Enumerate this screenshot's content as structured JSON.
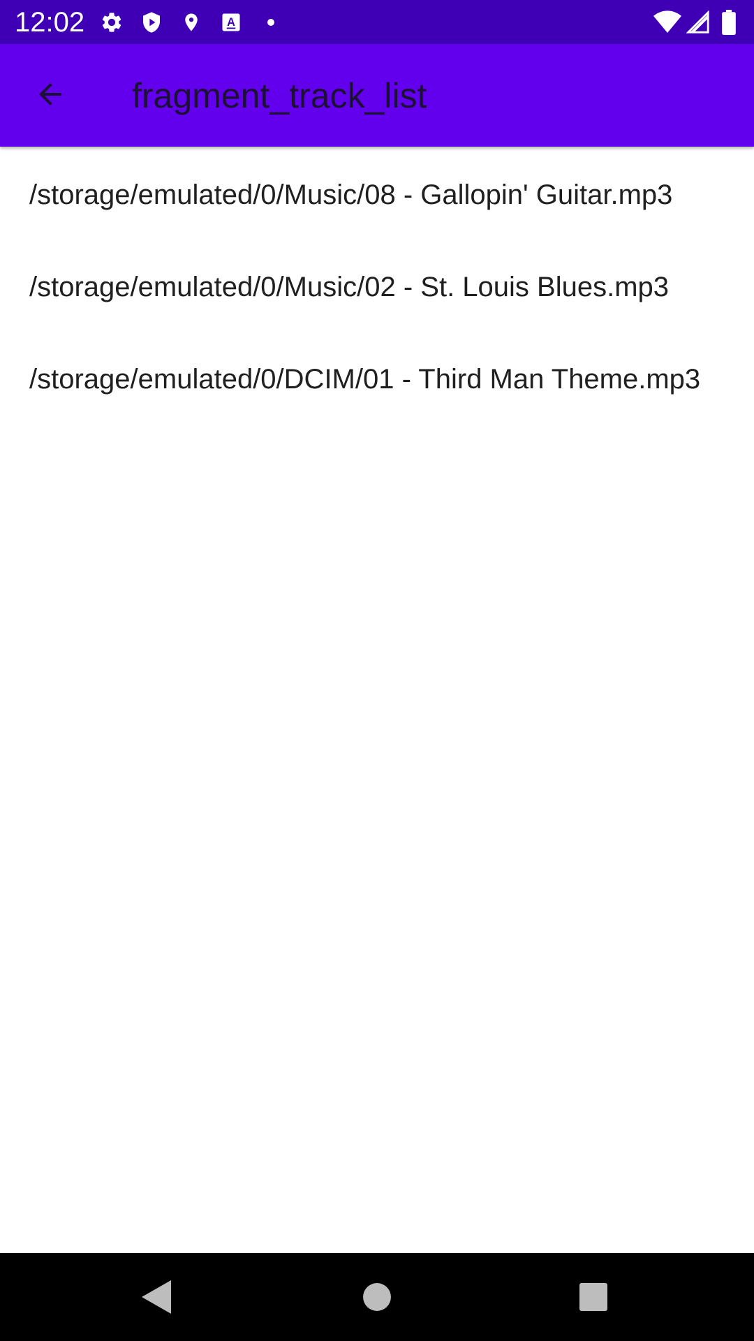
{
  "colors": {
    "status_bar": "#3f00b5",
    "app_bar": "#6200ee",
    "title_text": "#1c1034",
    "list_text": "#1f1f1f",
    "nav_bar": "#000000",
    "nav_icons": "#bdbdbd"
  },
  "status_bar": {
    "time": "12:02",
    "left_icons": [
      "settings-gear-icon",
      "shield-icon",
      "location-pin-icon",
      "keyboard-a-icon",
      "dot-icon"
    ],
    "right_icons": [
      "wifi-icon",
      "cellular-signal-icon",
      "battery-icon"
    ]
  },
  "app_bar": {
    "back_icon": "arrow-back-icon",
    "title": "fragment_track_list"
  },
  "tracks": [
    {
      "path": "/storage/emulated/0/Music/08 - Gallopin' Guitar.mp3"
    },
    {
      "path": "/storage/emulated/0/Music/02 - St. Louis Blues.mp3"
    },
    {
      "path": "/storage/emulated/0/DCIM/01 - Third Man Theme.mp3"
    }
  ],
  "nav_bar": {
    "icons": [
      "back-triangle-icon",
      "home-circle-icon",
      "recents-square-icon"
    ]
  }
}
